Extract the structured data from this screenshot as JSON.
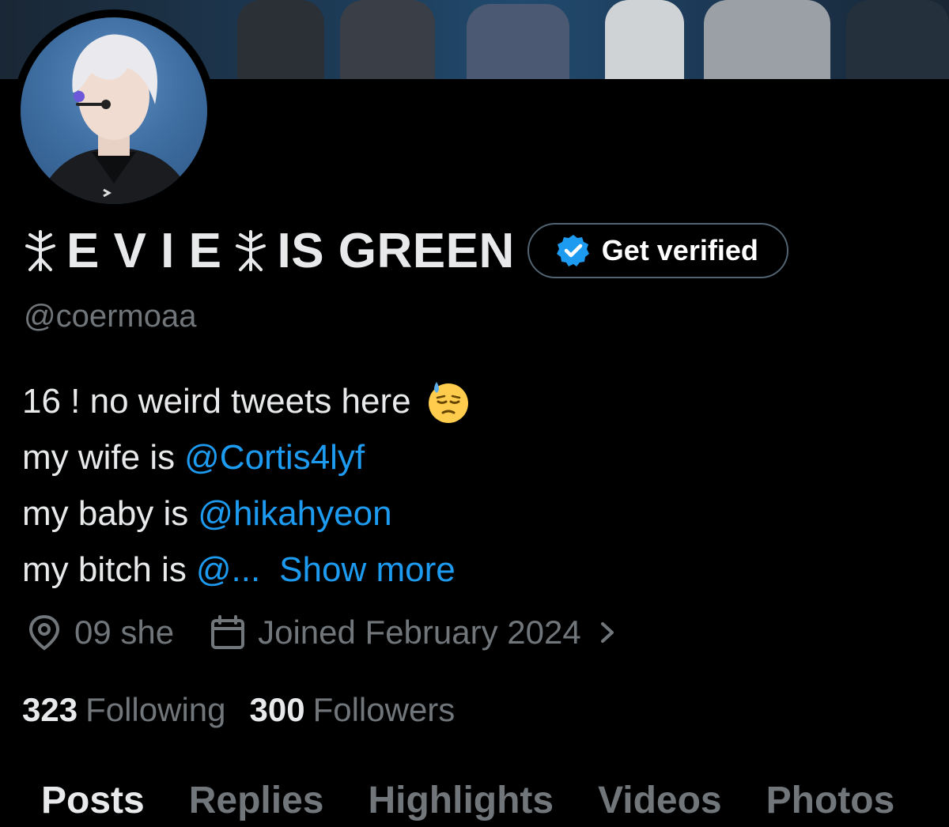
{
  "profile": {
    "name_part1": "E V I E",
    "name_part2": "IS GREEN",
    "handle": "@coermoaa",
    "get_verified_label": "Get verified"
  },
  "bio": {
    "line1_text": "16 ! no weird tweets here",
    "line1_emoji": "downcast-face-with-sweat-emoji",
    "line2_text": "my wife is",
    "line2_mention": "@Cortis4lyf",
    "line3_text": "my baby is",
    "line3_mention": "@hikahyeon",
    "line4_text": "my bitch is",
    "line4_mention": "@...",
    "show_more": "Show more"
  },
  "meta": {
    "location": "09 she",
    "location_icon": "location-pin-icon",
    "joined": "Joined February 2024",
    "joined_icon": "calendar-icon"
  },
  "stats": {
    "following_count": "323",
    "following_label": "Following",
    "followers_count": "300",
    "followers_label": "Followers"
  },
  "tabs": [
    "Posts",
    "Replies",
    "Highlights",
    "Videos",
    "Photos"
  ],
  "colors": {
    "accent": "#1d9bf0",
    "text": "#e7e9ea",
    "muted": "#71767b",
    "background": "#000000"
  }
}
